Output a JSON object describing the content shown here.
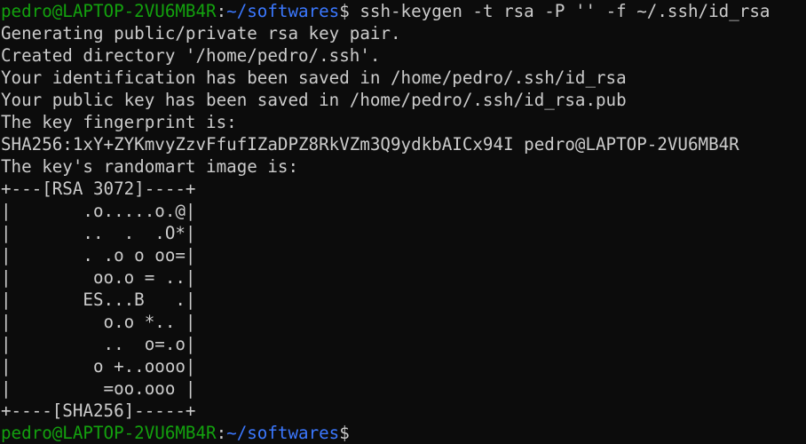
{
  "prompt": {
    "user_host": "pedro@LAPTOP-2VU6MB4R",
    "separator": ":",
    "cwd": "~/softwares",
    "symbol": "$"
  },
  "command": " ssh-keygen -t rsa -P '' -f ~/.ssh/id_rsa",
  "output": [
    "Generating public/private rsa key pair.",
    "Created directory '/home/pedro/.ssh'.",
    "Your identification has been saved in /home/pedro/.ssh/id_rsa",
    "Your public key has been saved in /home/pedro/.ssh/id_rsa.pub",
    "The key fingerprint is:",
    "SHA256:1xY+ZYKmvyZzvFfufIZaDPZ8RkVZm3Q9ydkbAICx94I pedro@LAPTOP-2VU6MB4R",
    "The key's randomart image is:",
    "+---[RSA 3072]----+",
    "|       .o.....o.@|",
    "|       ..  .  .O*|",
    "|       . .o o oo=|",
    "|        oo.o = ..|",
    "|       ES...B   .|",
    "|         o.o *.. |",
    "|         ..  o=.o|",
    "|        o +..oooo|",
    "|         =oo.ooo |",
    "+----[SHA256]-----+"
  ],
  "final_prompt": {
    "user_host": "pedro@LAPTOP-2VU6MB4R",
    "separator": ":",
    "cwd": "~/softwares",
    "symbol": "$"
  },
  "colors": {
    "background": "#0c0c0c",
    "text": "#cccccc",
    "prompt_user": "#13a10e",
    "prompt_path": "#3b78ff"
  }
}
